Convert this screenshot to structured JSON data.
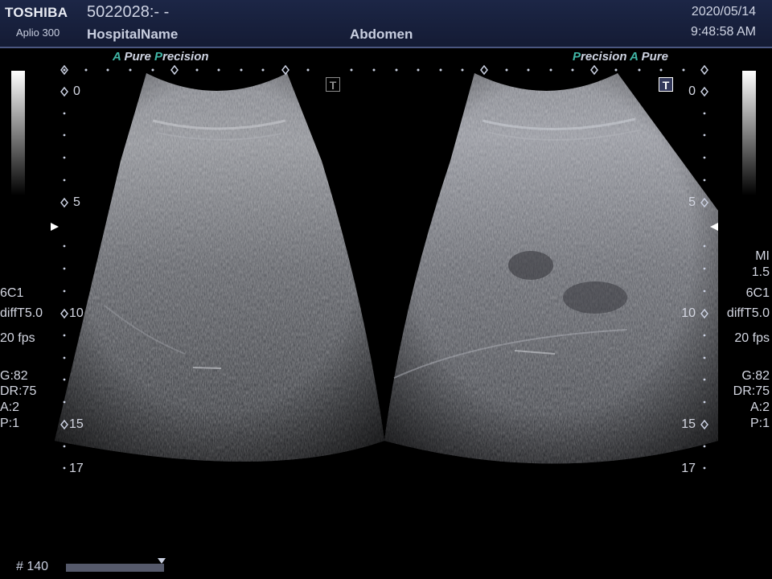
{
  "header": {
    "brand": "TOSHIBA",
    "model": "Aplio 300",
    "patient_id": "5022028:- -",
    "hospital": "HospitalName",
    "exam": "Abdomen",
    "date": "2020/05/14",
    "time": "9:48:58 AM"
  },
  "left_panel": {
    "mode_a": "A",
    "mode_pure": "Pure",
    "mode_p": "P",
    "mode_precision": "recision",
    "depth_labels": [
      "0",
      "5",
      "10",
      "15",
      "17"
    ],
    "probe": "6C1",
    "preset": "diffT5.0",
    "fps": "20 fps",
    "gain": "G:82",
    "dynamic_range": "DR:75",
    "a_value": "A:2",
    "p_value": "P:1",
    "t_icon": "T"
  },
  "right_panel": {
    "mode_p": "P",
    "mode_precision": "recision",
    "mode_a": "A",
    "mode_pure": "Pure",
    "depth_labels": [
      "0",
      "5",
      "10",
      "15",
      "17"
    ],
    "mi_label": "MI",
    "mi_value": "1.5",
    "probe": "6C1",
    "preset": "diffT5.0",
    "fps": "20 fps",
    "gain": "G:82",
    "dynamic_range": "DR:75",
    "a_value": "A:2",
    "p_value": "P:1",
    "t_icon": "T"
  },
  "cine": {
    "frame_counter": "# 140"
  }
}
